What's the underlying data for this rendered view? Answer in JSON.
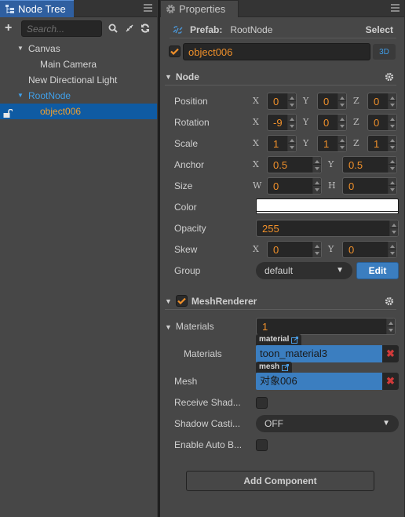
{
  "node_tree": {
    "tab_label": "Node Tree",
    "search_placeholder": "Search...",
    "items": [
      {
        "label": "Canvas",
        "expanded": true,
        "depth": 1
      },
      {
        "label": "Main Camera",
        "depth": 2
      },
      {
        "label": "New Directional Light",
        "depth": 1
      },
      {
        "label": "RootNode",
        "expanded": true,
        "depth": 1,
        "prefab": true
      },
      {
        "label": "object006",
        "depth": 2,
        "selected": true
      }
    ]
  },
  "properties": {
    "tab_label": "Properties",
    "prefab": {
      "label": "Prefab:",
      "name": "RootNode",
      "select_label": "Select"
    },
    "node_name": "object006",
    "node_active": true,
    "mode_3d_label": "3D",
    "node_section": {
      "title": "Node",
      "position": {
        "label": "Position",
        "x": "0",
        "y": "0",
        "z": "0"
      },
      "rotation": {
        "label": "Rotation",
        "x": "-9",
        "y": "0",
        "z": "0"
      },
      "scale": {
        "label": "Scale",
        "x": "1",
        "y": "1",
        "z": "1"
      },
      "anchor": {
        "label": "Anchor",
        "x": "0.5",
        "y": "0.5"
      },
      "size": {
        "label": "Size",
        "w": "0",
        "h": "0"
      },
      "color": {
        "label": "Color",
        "value": "#ffffff"
      },
      "opacity": {
        "label": "Opacity",
        "value": "255"
      },
      "skew": {
        "label": "Skew",
        "x": "0",
        "y": "0"
      },
      "group": {
        "label": "Group",
        "value": "default",
        "edit_label": "Edit"
      }
    },
    "axis_labels": {
      "x": "X",
      "y": "Y",
      "z": "Z",
      "w": "W",
      "h": "H"
    },
    "mesh_renderer": {
      "title": "MeshRenderer",
      "enabled": true,
      "materials_count": {
        "label": "Materials",
        "value": "1"
      },
      "material_item": {
        "label": "Materials",
        "tag": "material",
        "value": "toon_material3"
      },
      "mesh": {
        "label": "Mesh",
        "tag": "mesh",
        "value": "对象006"
      },
      "receive_shadows": {
        "label": "Receive Shad...",
        "checked": false
      },
      "shadow_casting": {
        "label": "Shadow Casti...",
        "value": "OFF"
      },
      "enable_auto_batch": {
        "label": "Enable Auto B...",
        "checked": false
      }
    },
    "add_component_label": "Add Component"
  },
  "colors": {
    "accent_blue": "#3b7ec0",
    "value_orange": "#f0902a",
    "prefab_blue": "#3fa0ea",
    "selected_row": "#0f5ba3",
    "remove_red": "#d03a3a"
  }
}
